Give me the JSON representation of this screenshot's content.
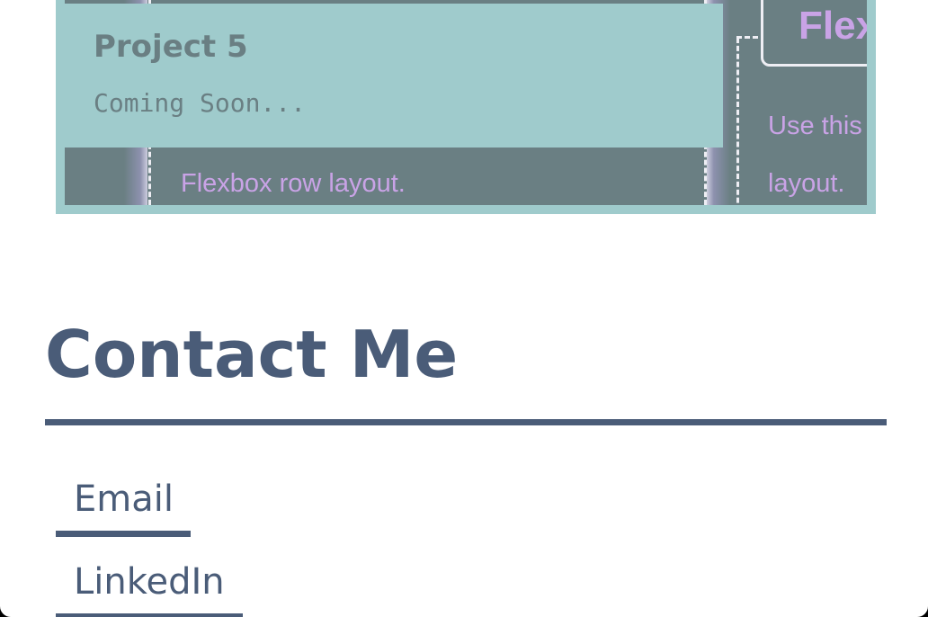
{
  "project": {
    "title": "Project 5",
    "description": "Coming Soon...",
    "preview": {
      "row_text": "Flexbox row layout.",
      "right_title": "Flex",
      "right_line1": "Use this",
      "right_line2": "layout."
    }
  },
  "contact": {
    "heading": "Contact Me",
    "links": [
      {
        "label": "Email"
      },
      {
        "label": "LinkedIn"
      }
    ]
  },
  "colors": {
    "card_bg": "#9fcbcc",
    "preview_bg": "#6a7f83",
    "preview_text": "#c9a3e6",
    "heading": "#4a5c78",
    "page_bg": "#ffffff"
  }
}
